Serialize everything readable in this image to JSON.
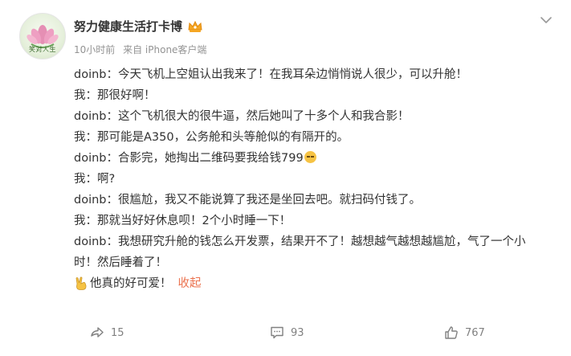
{
  "author": {
    "name": "努力健康生活打卡博",
    "avatar_caption": "笑对人生",
    "badge_icon": "crown-badge-icon"
  },
  "meta": {
    "time": "10小时前",
    "source": "来自 iPhone客户端"
  },
  "content": {
    "lines": [
      "doinb：今天飞机上空姐认出我来了！在我耳朵边悄悄说人很少，可以升舱！",
      "我：那很好啊！",
      "doinb：这个飞机很大的很牛逼，然后她叫了十多个人和我合影！",
      "我：那可能是A350，公务舱和头等舱似的有隔开的。",
      "doinb：合影完，她掏出二维码要我给钱799",
      "我：啊?",
      "doinb：很尴尬，我又不能说算了我还是坐回去吧。就扫码付钱了。",
      "我：那就当好好休息呗！2个小时睡一下！",
      "doinb：我想研究升舱的钱怎么开发票，结果开不了！越想越气越想越尴尬，气了一个小时！然后睡着了！"
    ],
    "closing": "他真的好可爱！",
    "collapse_label": "收起"
  },
  "actions": {
    "repost_count": "15",
    "comment_count": "93",
    "like_count": "767"
  },
  "colors": {
    "text": "#333333",
    "meta": "#939393",
    "link": "#eb7350"
  }
}
